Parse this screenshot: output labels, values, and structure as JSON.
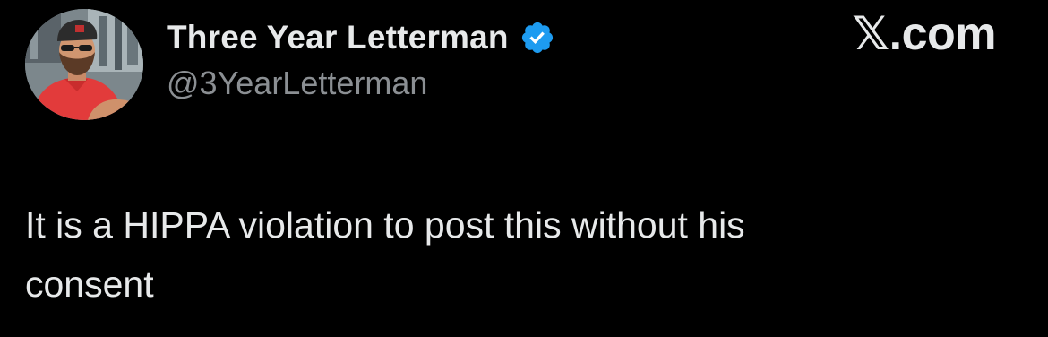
{
  "tweet": {
    "author": {
      "display_name": "Three Year Letterman",
      "handle": "@3YearLetterman",
      "verified": true,
      "verified_icon": "verified-badge-icon",
      "avatar_icon": "profile-photo"
    },
    "site_label": "𝕏.com",
    "text": "It is a HIPPA violation to post this without his\nconsent"
  },
  "colors": {
    "background": "#000000",
    "primary_text": "#e7e9ea",
    "secondary_text": "#8b8f93",
    "verified_blue": "#1d9bf0"
  }
}
